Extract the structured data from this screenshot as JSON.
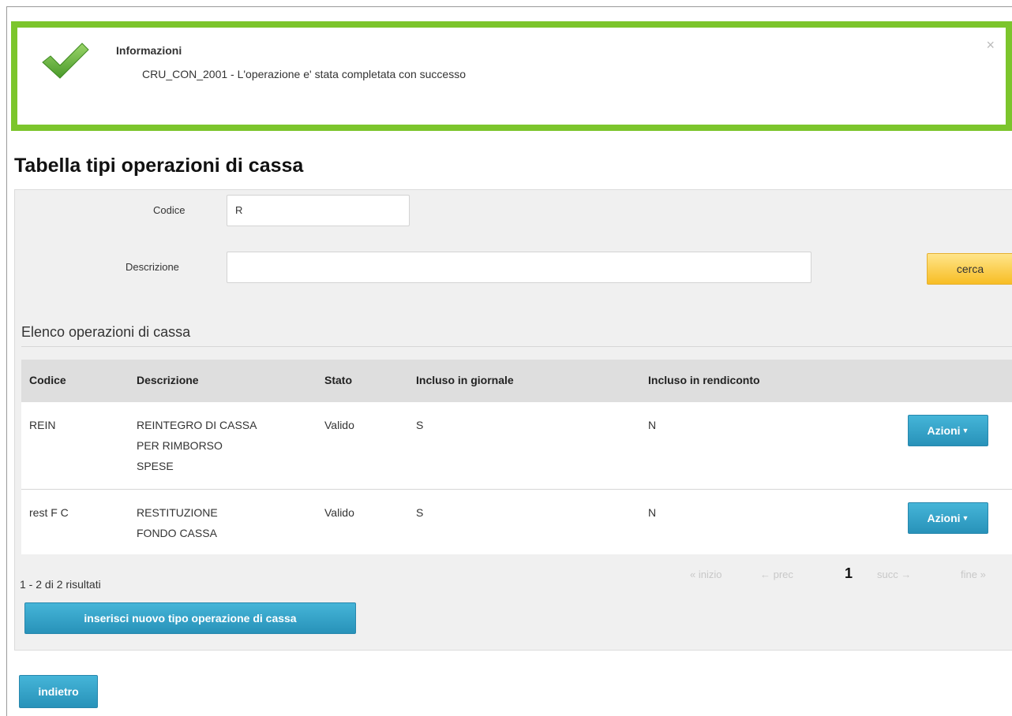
{
  "alert": {
    "title": "Informazioni",
    "message": "CRU_CON_2001 - L'operazione e' stata completata con successo",
    "close": "×",
    "color": "#7cc52c"
  },
  "page": {
    "title": "Tabella tipi operazioni di cassa"
  },
  "search": {
    "codice_label": "Codice",
    "codice_value": "R",
    "descrizione_label": "Descrizione",
    "descrizione_value": "",
    "cerca_label": "cerca"
  },
  "list": {
    "title": "Elenco operazioni di cassa",
    "columns": [
      "Codice",
      "Descrizione",
      "Stato",
      "Incluso in giornale",
      "Incluso in rendiconto"
    ],
    "rows": [
      {
        "codice": "REIN",
        "descrizione": [
          "REINTEGRO DI CASSA",
          "PER RIMBORSO",
          "SPESE"
        ],
        "stato": "Valido",
        "giornale": "S",
        "rendiconto": "N",
        "action": "Azioni"
      },
      {
        "codice": "rest F C",
        "descrizione": [
          "RESTITUZIONE",
          "FONDO CASSA"
        ],
        "stato": "Valido",
        "giornale": "S",
        "rendiconto": "N",
        "action": "Azioni"
      }
    ],
    "results_text": "1 - 2 di 2 risultati",
    "pager": {
      "first": "« inizio",
      "prev": "← prec",
      "current": "1",
      "next": "succ →",
      "last": "fine »"
    },
    "new_button": "inserisci nuovo tipo operazione di cassa"
  },
  "back_button": "indietro"
}
